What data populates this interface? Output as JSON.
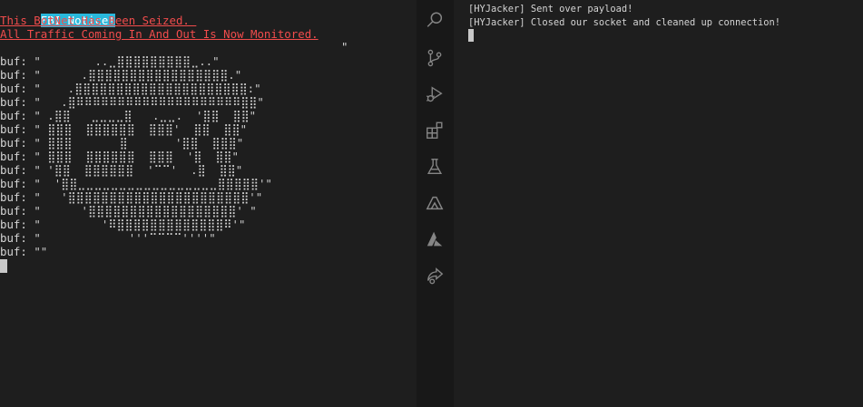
{
  "left_terminal": {
    "notice": "FBI Notice!",
    "alert_line_1": "This BotNet Has Been Seized. ",
    "alert_line_2": "All Traffic Coming In And Out Is Now Monitored.",
    "stray_quote": "\"",
    "buf_prefix": "buf: ",
    "art_lines": [
      "\"        ..⣀⣿⣿⣿⣿⣿⣿⣿⣿⣿⣀..\"",
      "\"      .⣿⣿⣿⣿⣿⣿⣿⣿⣿⣿⣿⣿⣿⣿⣿⣿⣿.\"",
      "\"    .⣿⣿⣿⣿⣿⣿⣿⣿⣿⣿⣿⣿⣿⣿⣿⣿⣿⣿⣿⣿⣿:\"",
      "\"   .⣿⠿⠿⠿⠿⠿⠿⠿⠿⠿⠿⠿⠿⠿⠿⠿⠿⠿⠿⠿⠿⣿⣿\"",
      "\" .⣿⣿   ⣀⣀⣀⣀⣿   .⣀⣀.  '⣿⣿  ⣿⣿\"",
      "\" ⣿⣿⣿  ⣿⣿⣿⣿⣿⣿  ⣿⣿⣿'  ⣿⣿  ⣿⣿\"",
      "\" ⣿⣿⣿       ⣿       '⣿⣿  ⣿⣿⣿\"",
      "\" ⣿⣿⣿  ⣿⣿⣿⣿⣿⣿  ⣿⣿⣿  '⣿  ⣿⣿\"",
      "\" '⣿⣿  ⣿⣿⣿⣿⣿⣿  '⠉⠉'  .⣿  ⣿⣿\"",
      "\"  '⣿⣿⣀⣀⣀⣀⣀⣀⣀⣀⣀⣀⣀⣀⣀⣀⣀⣀⣀⣿⣿⣿⣿⣿'\"",
      "\"   '⣿⣿⣿⣿⣿⣿⣿⣿⣿⣿⣿⣿⣿⣿⣿⣿⣿⣿⣿⣿⣿⣿'\"",
      "\"      '⣿⣿⣿⣿⣿⣿⣿⣿⣿⣿⣿⣿⣿⣿⣿⣿⣿⣿' \"",
      "\"         '⠿⣿⣿⣿⣿⣿⣿⣿⣿⣿⣿⣿⣿⣿⠿'\"",
      "\"             '''⠉⠉⠉⠉''''\"",
      "\"\""
    ]
  },
  "activity_bar": {
    "icons": [
      "search-icon",
      "source-control-icon",
      "run-debug-icon",
      "extensions-icon",
      "testing-icon",
      "azure-icon",
      "azure-a-icon",
      "live-share-icon"
    ]
  },
  "right_terminal": {
    "lines": [
      "[HYJacker] Sent over payload!",
      "[HYJacker] Closed our socket and cleaned up connection!"
    ]
  }
}
